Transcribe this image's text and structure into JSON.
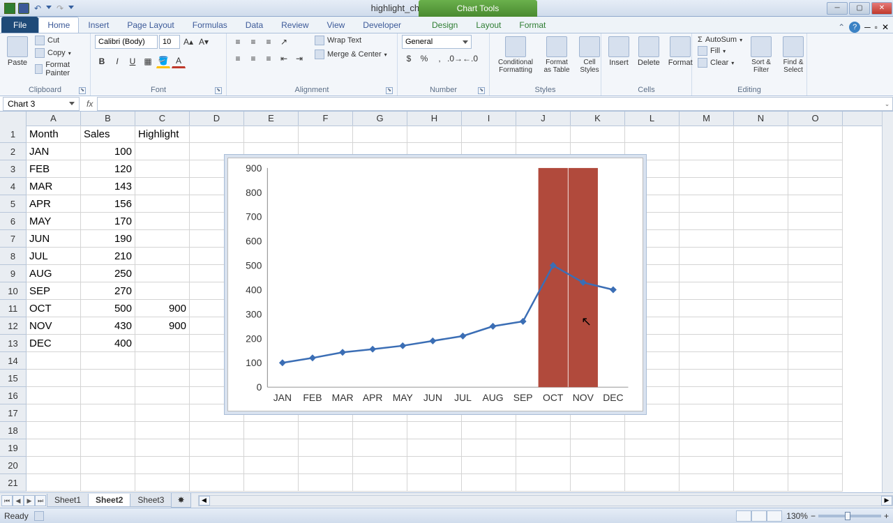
{
  "title": "highlight_chart_section - Microsoft Excel",
  "chart_tools": "Chart Tools",
  "tabs": {
    "file": "File",
    "home": "Home",
    "insert": "Insert",
    "page_layout": "Page Layout",
    "formulas": "Formulas",
    "data": "Data",
    "review": "Review",
    "view": "View",
    "developer": "Developer",
    "design": "Design",
    "layout": "Layout",
    "format": "Format"
  },
  "ribbon": {
    "clipboard": {
      "label": "Clipboard",
      "paste": "Paste",
      "cut": "Cut",
      "copy": "Copy",
      "format_painter": "Format Painter"
    },
    "font": {
      "label": "Font",
      "name": "Calibri (Body)",
      "size": "10"
    },
    "alignment": {
      "label": "Alignment",
      "wrap": "Wrap Text",
      "merge": "Merge & Center"
    },
    "number": {
      "label": "Number",
      "format": "General"
    },
    "styles": {
      "label": "Styles",
      "cond": "Conditional Formatting",
      "table": "Format as Table",
      "cell": "Cell Styles"
    },
    "cells": {
      "label": "Cells",
      "insert": "Insert",
      "delete": "Delete",
      "format": "Format"
    },
    "editing": {
      "label": "Editing",
      "autosum": "AutoSum",
      "fill": "Fill",
      "clear": "Clear",
      "sort": "Sort & Filter",
      "find": "Find & Select"
    }
  },
  "namebox": "Chart 3",
  "formula": "",
  "columns": [
    "A",
    "B",
    "C",
    "D",
    "E",
    "F",
    "G",
    "H",
    "I",
    "J",
    "K",
    "L",
    "M",
    "N",
    "O"
  ],
  "rownums": [
    1,
    2,
    3,
    4,
    5,
    6,
    7,
    8,
    9,
    10,
    11,
    12,
    13,
    14,
    15,
    16,
    17,
    18,
    19,
    20,
    21
  ],
  "sheet_data": {
    "headers": [
      "Month",
      "Sales",
      "Highlight"
    ],
    "rows": [
      {
        "a": "JAN",
        "b": "100",
        "c": ""
      },
      {
        "a": "FEB",
        "b": "120",
        "c": ""
      },
      {
        "a": "MAR",
        "b": "143",
        "c": ""
      },
      {
        "a": "APR",
        "b": "156",
        "c": ""
      },
      {
        "a": "MAY",
        "b": "170",
        "c": ""
      },
      {
        "a": "JUN",
        "b": "190",
        "c": ""
      },
      {
        "a": "JUL",
        "b": "210",
        "c": ""
      },
      {
        "a": "AUG",
        "b": "250",
        "c": ""
      },
      {
        "a": "SEP",
        "b": "270",
        "c": ""
      },
      {
        "a": "OCT",
        "b": "500",
        "c": "900"
      },
      {
        "a": "NOV",
        "b": "430",
        "c": "900"
      },
      {
        "a": "DEC",
        "b": "400",
        "c": ""
      }
    ]
  },
  "chart_data": {
    "type": "combo",
    "categories": [
      "JAN",
      "FEB",
      "MAR",
      "APR",
      "MAY",
      "JUN",
      "JUL",
      "AUG",
      "SEP",
      "OCT",
      "NOV",
      "DEC"
    ],
    "series": [
      {
        "name": "Sales",
        "type": "line",
        "values": [
          100,
          120,
          143,
          156,
          170,
          190,
          210,
          250,
          270,
          500,
          430,
          400
        ],
        "color": "#3b6eb5"
      },
      {
        "name": "Highlight",
        "type": "bar",
        "values": [
          null,
          null,
          null,
          null,
          null,
          null,
          null,
          null,
          null,
          900,
          900,
          null
        ],
        "color": "#b14a3c"
      }
    ],
    "ylim": [
      0,
      900
    ],
    "yticks": [
      0,
      100,
      200,
      300,
      400,
      500,
      600,
      700,
      800,
      900
    ]
  },
  "sheets": {
    "s1": "Sheet1",
    "s2": "Sheet2",
    "s3": "Sheet3"
  },
  "status": {
    "ready": "Ready",
    "zoom": "130%"
  }
}
